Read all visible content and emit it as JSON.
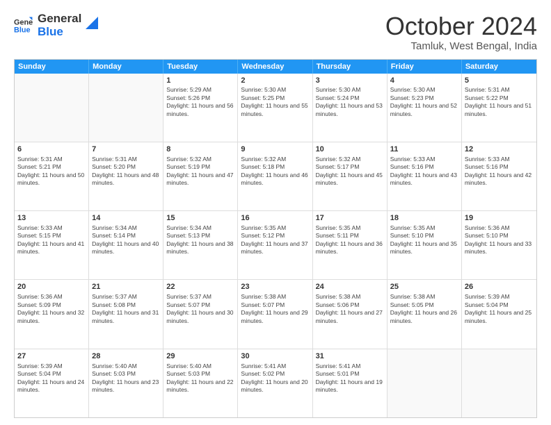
{
  "logo": {
    "line1": "General",
    "line2": "Blue"
  },
  "title": "October 2024",
  "location": "Tamluk, West Bengal, India",
  "header_days": [
    "Sunday",
    "Monday",
    "Tuesday",
    "Wednesday",
    "Thursday",
    "Friday",
    "Saturday"
  ],
  "weeks": [
    [
      {
        "day": "",
        "sunrise": "",
        "sunset": "",
        "daylight": ""
      },
      {
        "day": "",
        "sunrise": "",
        "sunset": "",
        "daylight": ""
      },
      {
        "day": "1",
        "sunrise": "Sunrise: 5:29 AM",
        "sunset": "Sunset: 5:26 PM",
        "daylight": "Daylight: 11 hours and 56 minutes."
      },
      {
        "day": "2",
        "sunrise": "Sunrise: 5:30 AM",
        "sunset": "Sunset: 5:25 PM",
        "daylight": "Daylight: 11 hours and 55 minutes."
      },
      {
        "day": "3",
        "sunrise": "Sunrise: 5:30 AM",
        "sunset": "Sunset: 5:24 PM",
        "daylight": "Daylight: 11 hours and 53 minutes."
      },
      {
        "day": "4",
        "sunrise": "Sunrise: 5:30 AM",
        "sunset": "Sunset: 5:23 PM",
        "daylight": "Daylight: 11 hours and 52 minutes."
      },
      {
        "day": "5",
        "sunrise": "Sunrise: 5:31 AM",
        "sunset": "Sunset: 5:22 PM",
        "daylight": "Daylight: 11 hours and 51 minutes."
      }
    ],
    [
      {
        "day": "6",
        "sunrise": "Sunrise: 5:31 AM",
        "sunset": "Sunset: 5:21 PM",
        "daylight": "Daylight: 11 hours and 50 minutes."
      },
      {
        "day": "7",
        "sunrise": "Sunrise: 5:31 AM",
        "sunset": "Sunset: 5:20 PM",
        "daylight": "Daylight: 11 hours and 48 minutes."
      },
      {
        "day": "8",
        "sunrise": "Sunrise: 5:32 AM",
        "sunset": "Sunset: 5:19 PM",
        "daylight": "Daylight: 11 hours and 47 minutes."
      },
      {
        "day": "9",
        "sunrise": "Sunrise: 5:32 AM",
        "sunset": "Sunset: 5:18 PM",
        "daylight": "Daylight: 11 hours and 46 minutes."
      },
      {
        "day": "10",
        "sunrise": "Sunrise: 5:32 AM",
        "sunset": "Sunset: 5:17 PM",
        "daylight": "Daylight: 11 hours and 45 minutes."
      },
      {
        "day": "11",
        "sunrise": "Sunrise: 5:33 AM",
        "sunset": "Sunset: 5:16 PM",
        "daylight": "Daylight: 11 hours and 43 minutes."
      },
      {
        "day": "12",
        "sunrise": "Sunrise: 5:33 AM",
        "sunset": "Sunset: 5:16 PM",
        "daylight": "Daylight: 11 hours and 42 minutes."
      }
    ],
    [
      {
        "day": "13",
        "sunrise": "Sunrise: 5:33 AM",
        "sunset": "Sunset: 5:15 PM",
        "daylight": "Daylight: 11 hours and 41 minutes."
      },
      {
        "day": "14",
        "sunrise": "Sunrise: 5:34 AM",
        "sunset": "Sunset: 5:14 PM",
        "daylight": "Daylight: 11 hours and 40 minutes."
      },
      {
        "day": "15",
        "sunrise": "Sunrise: 5:34 AM",
        "sunset": "Sunset: 5:13 PM",
        "daylight": "Daylight: 11 hours and 38 minutes."
      },
      {
        "day": "16",
        "sunrise": "Sunrise: 5:35 AM",
        "sunset": "Sunset: 5:12 PM",
        "daylight": "Daylight: 11 hours and 37 minutes."
      },
      {
        "day": "17",
        "sunrise": "Sunrise: 5:35 AM",
        "sunset": "Sunset: 5:11 PM",
        "daylight": "Daylight: 11 hours and 36 minutes."
      },
      {
        "day": "18",
        "sunrise": "Sunrise: 5:35 AM",
        "sunset": "Sunset: 5:10 PM",
        "daylight": "Daylight: 11 hours and 35 minutes."
      },
      {
        "day": "19",
        "sunrise": "Sunrise: 5:36 AM",
        "sunset": "Sunset: 5:10 PM",
        "daylight": "Daylight: 11 hours and 33 minutes."
      }
    ],
    [
      {
        "day": "20",
        "sunrise": "Sunrise: 5:36 AM",
        "sunset": "Sunset: 5:09 PM",
        "daylight": "Daylight: 11 hours and 32 minutes."
      },
      {
        "day": "21",
        "sunrise": "Sunrise: 5:37 AM",
        "sunset": "Sunset: 5:08 PM",
        "daylight": "Daylight: 11 hours and 31 minutes."
      },
      {
        "day": "22",
        "sunrise": "Sunrise: 5:37 AM",
        "sunset": "Sunset: 5:07 PM",
        "daylight": "Daylight: 11 hours and 30 minutes."
      },
      {
        "day": "23",
        "sunrise": "Sunrise: 5:38 AM",
        "sunset": "Sunset: 5:07 PM",
        "daylight": "Daylight: 11 hours and 29 minutes."
      },
      {
        "day": "24",
        "sunrise": "Sunrise: 5:38 AM",
        "sunset": "Sunset: 5:06 PM",
        "daylight": "Daylight: 11 hours and 27 minutes."
      },
      {
        "day": "25",
        "sunrise": "Sunrise: 5:38 AM",
        "sunset": "Sunset: 5:05 PM",
        "daylight": "Daylight: 11 hours and 26 minutes."
      },
      {
        "day": "26",
        "sunrise": "Sunrise: 5:39 AM",
        "sunset": "Sunset: 5:04 PM",
        "daylight": "Daylight: 11 hours and 25 minutes."
      }
    ],
    [
      {
        "day": "27",
        "sunrise": "Sunrise: 5:39 AM",
        "sunset": "Sunset: 5:04 PM",
        "daylight": "Daylight: 11 hours and 24 minutes."
      },
      {
        "day": "28",
        "sunrise": "Sunrise: 5:40 AM",
        "sunset": "Sunset: 5:03 PM",
        "daylight": "Daylight: 11 hours and 23 minutes."
      },
      {
        "day": "29",
        "sunrise": "Sunrise: 5:40 AM",
        "sunset": "Sunset: 5:03 PM",
        "daylight": "Daylight: 11 hours and 22 minutes."
      },
      {
        "day": "30",
        "sunrise": "Sunrise: 5:41 AM",
        "sunset": "Sunset: 5:02 PM",
        "daylight": "Daylight: 11 hours and 20 minutes."
      },
      {
        "day": "31",
        "sunrise": "Sunrise: 5:41 AM",
        "sunset": "Sunset: 5:01 PM",
        "daylight": "Daylight: 11 hours and 19 minutes."
      },
      {
        "day": "",
        "sunrise": "",
        "sunset": "",
        "daylight": ""
      },
      {
        "day": "",
        "sunrise": "",
        "sunset": "",
        "daylight": ""
      }
    ]
  ]
}
